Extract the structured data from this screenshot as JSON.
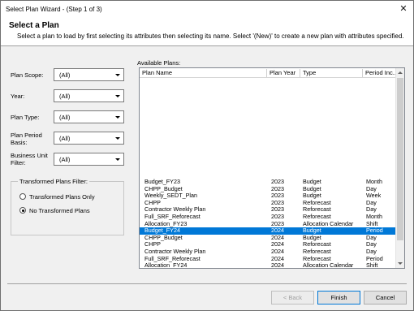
{
  "window": {
    "title": "Select Plan Wizard - (Step 1 of 3)",
    "close_glyph": "✕"
  },
  "header": {
    "title": "Select a Plan",
    "description": "Select a plan to load by first selecting its attributes then selecting its name.  Select '(New)' to create a new plan with attributes specified."
  },
  "filters": [
    {
      "label": "Plan Scope:",
      "value": "(All)"
    },
    {
      "label": "Year:",
      "value": "(All)"
    },
    {
      "label": "Plan Type:",
      "value": "(All)"
    },
    {
      "label": "Plan Period Basis:",
      "value": "(All)"
    },
    {
      "label": "Business Unit Filter:",
      "value": "(All)"
    }
  ],
  "transformed_filter": {
    "legend": "Transformed Plans Filter:",
    "options": [
      {
        "label": "Transformed Plans Only",
        "checked": false
      },
      {
        "label": "No Transformed Plans",
        "checked": true
      }
    ]
  },
  "available_plans": {
    "label": "Available Plans:",
    "columns": [
      "Plan Name",
      "Plan Year",
      "Type",
      "Period Inc..."
    ],
    "rows": [
      [
        "Budget_FY23",
        "2023",
        "Budget",
        "Month"
      ],
      [
        "CHPP_Budget",
        "2023",
        "Budget",
        "Day"
      ],
      [
        "Weekly_SEDT_Plan",
        "2023",
        "Budget",
        "Week"
      ],
      [
        "CHPP",
        "2023",
        "Reforecast",
        "Day"
      ],
      [
        "Contractor Weekly Plan",
        "2023",
        "Reforecast",
        "Day"
      ],
      [
        "Full_SRF_Reforecast",
        "2023",
        "Reforecast",
        "Month"
      ],
      [
        "Allocation_FY23",
        "2023",
        "Allocation Calendar",
        "Shift"
      ],
      [
        "Budget_FY24",
        "2024",
        "Budget",
        "Period"
      ],
      [
        "CHPP_Budget",
        "2024",
        "Budget",
        "Day"
      ],
      [
        "CHPP",
        "2024",
        "Reforecast",
        "Day"
      ],
      [
        "Contractor Weekly Plan",
        "2024",
        "Reforecast",
        "Day"
      ],
      [
        "Full_SRF_Reforecast",
        "2024",
        "Reforecast",
        "Period"
      ],
      [
        "Allocation_FY24",
        "2024",
        "Allocation Calendar",
        "Shift"
      ]
    ],
    "selected_row": 7
  },
  "buttons": {
    "back": "< Back",
    "finish": "Finish",
    "cancel": "Cancel"
  },
  "colors": {
    "selection": "#0078d7",
    "window_bg": "#f0f0f0"
  }
}
